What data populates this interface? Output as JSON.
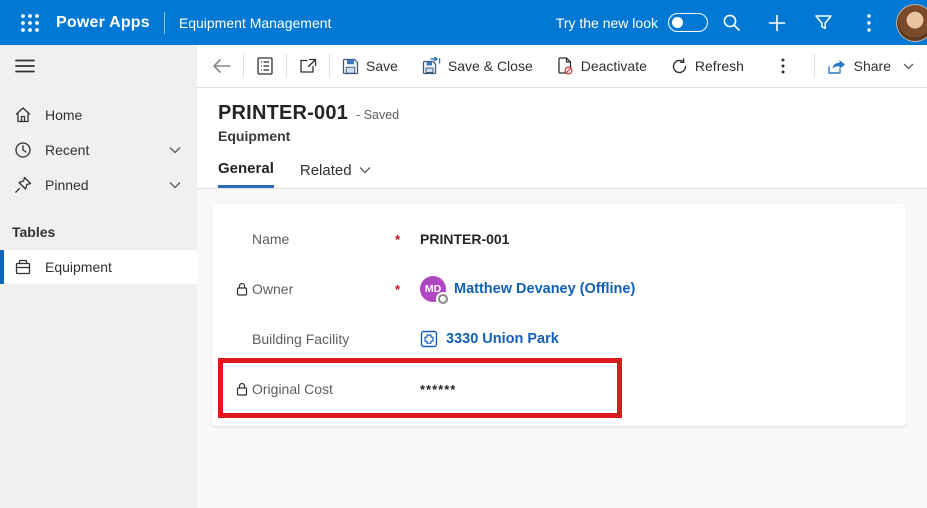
{
  "header": {
    "brand": "Power Apps",
    "app_name": "Equipment Management",
    "new_look_label": "Try the new look",
    "accent_color": "#0078d4"
  },
  "toolbar": {
    "save_label": "Save",
    "save_close_label": "Save & Close",
    "deactivate_label": "Deactivate",
    "refresh_label": "Refresh",
    "share_label": "Share"
  },
  "record": {
    "title": "PRINTER-001",
    "status": "- Saved",
    "entity": "Equipment",
    "tabs": [
      {
        "label": "General",
        "active": true
      },
      {
        "label": "Related",
        "active": false
      }
    ]
  },
  "sidebar": {
    "items": [
      {
        "label": "Home"
      },
      {
        "label": "Recent"
      },
      {
        "label": "Pinned"
      }
    ],
    "section_header": "Tables",
    "table_item": "Equipment"
  },
  "form": {
    "required_marker": "*",
    "fields": [
      {
        "label": "Name",
        "required": true,
        "locked": false,
        "type": "text",
        "value": "PRINTER-001"
      },
      {
        "label": "Owner",
        "required": true,
        "locked": true,
        "type": "lookup-user",
        "value": "Matthew Devaney (Offline)",
        "avatar_initials": "MD",
        "avatar_color": "#b146c2",
        "presence": "Offline"
      },
      {
        "label": "Building Facility",
        "required": false,
        "locked": false,
        "type": "lookup-table",
        "value": "3330 Union Park"
      },
      {
        "label": "Original Cost",
        "required": false,
        "locked": true,
        "type": "masked",
        "value": "******"
      }
    ],
    "highlight_color": "#e0191e",
    "link_color": "#1160b7"
  },
  "icons": [
    "waffle-icon",
    "search-icon",
    "add-icon",
    "filter-icon",
    "more-vertical-icon",
    "back-icon",
    "form-icon",
    "popout-icon",
    "save-icon",
    "save-close-icon",
    "deactivate-icon",
    "refresh-icon",
    "share-icon",
    "chevron-down-icon",
    "home-icon",
    "recent-icon",
    "pinned-icon",
    "table-icon",
    "lock-icon",
    "hamburger-icon"
  ]
}
